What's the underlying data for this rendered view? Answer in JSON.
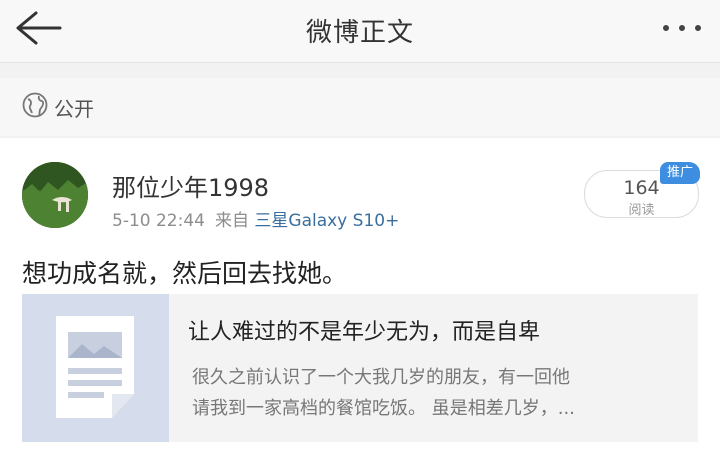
{
  "header": {
    "title": "微博正文"
  },
  "visibility": {
    "label": "公开"
  },
  "post": {
    "username": "那位少年1998",
    "time": "5-10 22:44",
    "source_prefix": "来自",
    "device": "三星Galaxy S10+",
    "views_count": "164",
    "views_label": "阅读",
    "promo_label": "推广",
    "text": "想功成名就，然后回去找她。"
  },
  "article": {
    "title": "让人难过的不是年少无为，而是自卑",
    "summary_line1": "很久之前认识了一个大我几岁的朋友，有一回他",
    "summary_line2": "请我到一家高档的餐馆吃饭。 虽是相差几岁，..."
  },
  "icons": {
    "back": "back-arrow-icon",
    "more": "more-dots-icon",
    "globe": "globe-icon",
    "doc": "article-doc-icon"
  },
  "colors": {
    "link": "#3b6e9e",
    "badge": "#3d8de1",
    "card_bg": "#f3f3f3",
    "thumb_bg": "#d5dceb"
  }
}
